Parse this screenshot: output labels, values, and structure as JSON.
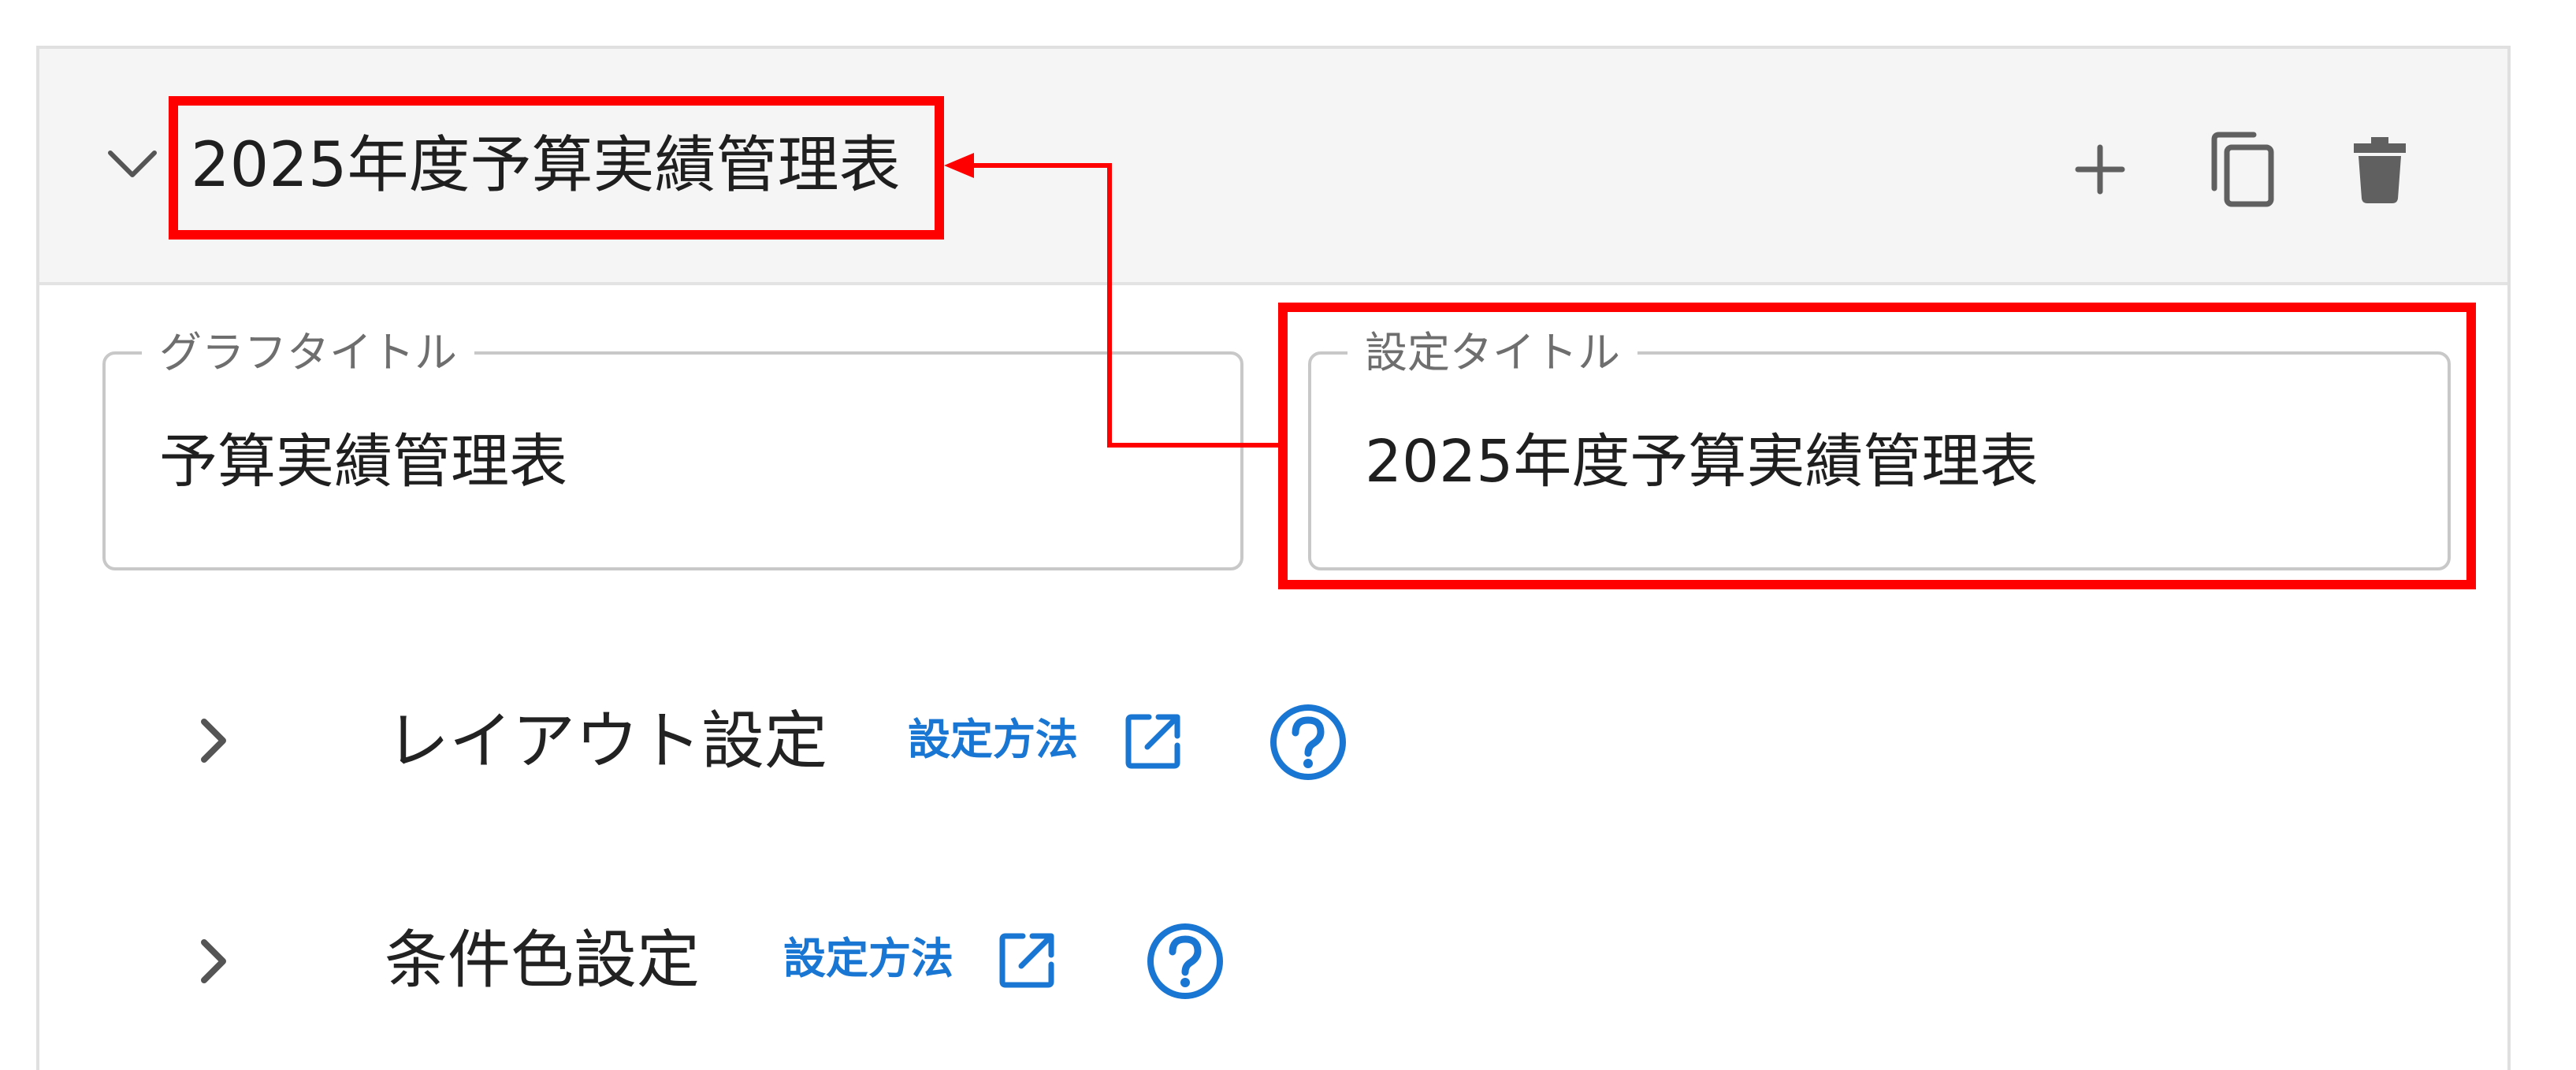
{
  "header": {
    "title": "2025年度予算実績管理表",
    "icons": {
      "collapse": "chevron-down-icon",
      "add": "plus-icon",
      "copy": "copy-icon",
      "delete": "trash-icon"
    }
  },
  "fields": {
    "graph_title": {
      "label": "グラフタイトル",
      "value": "予算実績管理表"
    },
    "setting_title": {
      "label": "設定タイトル",
      "value": "2025年度予算実績管理表"
    }
  },
  "sections": [
    {
      "label": "レイアウト設定",
      "link_label": "設定方法",
      "link_icon": "external-link-icon",
      "help_icon": "help-circle-icon"
    },
    {
      "label": "条件色設定",
      "link_label": "設定方法",
      "link_icon": "external-link-icon",
      "help_icon": "help-circle-icon"
    }
  ],
  "colors": {
    "annotation": "#ff0000",
    "link": "#1976d2",
    "header_bg": "#f5f5f5",
    "icon_gray": "#606060"
  }
}
